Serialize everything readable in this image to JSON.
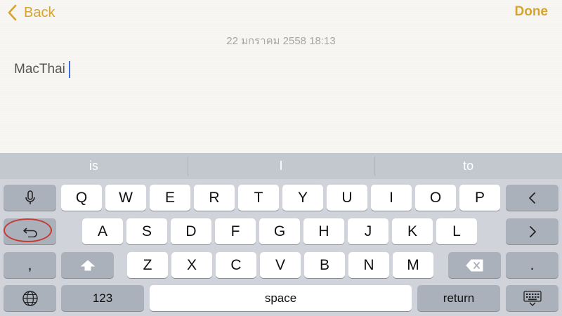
{
  "nav": {
    "back_label": "Back",
    "done_label": "Done"
  },
  "note": {
    "timestamp": "22 มกราคม 2558 18:13",
    "text": "MacThai"
  },
  "suggestions": [
    "is",
    "I",
    "to"
  ],
  "keys": {
    "row1": [
      "Q",
      "W",
      "E",
      "R",
      "T",
      "Y",
      "U",
      "I",
      "O",
      "P"
    ],
    "row2": [
      "A",
      "S",
      "D",
      "F",
      "G",
      "H",
      "J",
      "K",
      "L"
    ],
    "row3": [
      "Z",
      "X",
      "C",
      "V",
      "B",
      "N",
      "M"
    ],
    "comma": ",",
    "period": ".",
    "numbers": "123",
    "space": "space",
    "return": "return"
  },
  "icons": {
    "back": "chevron-left-icon",
    "mic": "microphone-icon",
    "undo": "undo-icon",
    "left": "cursor-left-icon",
    "right": "cursor-right-icon",
    "shift": "shift-icon",
    "delete": "delete-icon",
    "globe": "globe-icon",
    "hide_keyboard": "keyboard-dismiss-icon"
  },
  "colors": {
    "accent": "#d6a42f",
    "caret": "#3f6fe2",
    "highlight_circle": "#c83a34"
  }
}
